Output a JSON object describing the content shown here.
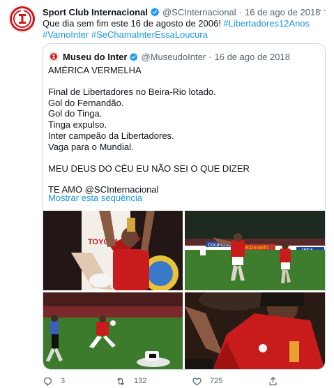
{
  "tweet": {
    "author_name": "Sport Club Internacional",
    "author_handle": "@SCInternacional",
    "separator": "·",
    "date": "16 de ago de 2018",
    "more": "···",
    "text_prefix": "Que dia sem fim este 16 de agosto de 2006! ",
    "hashtags": [
      "#Libertadores12Anos",
      "#VamoInter",
      "#SeChamaInterEssaLoucura"
    ]
  },
  "quote": {
    "author_name": "Museu do Inter",
    "author_handle": "@MuseudoInter",
    "separator": "·",
    "date": "16 de ago de 2018",
    "lines": {
      "l1": "AMÉRICA VERMELHA",
      "l2": "Final de Libertadores no Beira-Rio lotado.",
      "l3": "Gol do Fernandão.",
      "l4": "Gol do Tinga.",
      "l5": "Tinga expulso.",
      "l6": "Inter campeão da Libertadores.",
      "l7": "Vaga para o Mundial.",
      "l8": "MEU DEUS DO CÉU EU NÃO SEI O QUE DIZER",
      "l9": "TE AMO @SCInternacional"
    },
    "show_thread": "Mostrar esta sequência",
    "banner_text": {
      "toyota": "TOYOTA",
      "coca": "Coca-Cola",
      "mcdonalds": "McDonald's",
      "visa": "VISA"
    }
  },
  "actions": {
    "replies": "3",
    "retweets": "132",
    "likes": "725"
  },
  "colors": {
    "inter_red": "#d1161b",
    "link_blue": "#1b95e0",
    "verified_blue": "#1d9bf0",
    "muted": "#536471"
  }
}
